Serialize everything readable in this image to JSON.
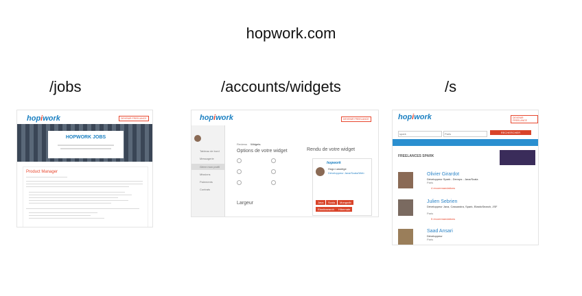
{
  "page": {
    "title": "hopwork.com",
    "labels": [
      "/jobs",
      "/accounts/widgets",
      "/s"
    ]
  },
  "jobs": {
    "logo": "hopwork",
    "banner_title": "HOPWORK JOBS",
    "post_title": "Product Manager",
    "cta": "DEVENIR FREELANCE"
  },
  "widgets": {
    "logo": "hopwork",
    "cta": "DEVENIR FREELANCE",
    "tabs": [
      "Reviews",
      "Widgets"
    ],
    "options_title": "Options de votre widget",
    "render_title": "Rendu de votre widget",
    "largeur": "Largeur",
    "sidebar": [
      "Tableau de bord",
      "Messagerie",
      "Gérer mon profil",
      "Missions",
      "Paiements",
      "Contrats"
    ],
    "card_name": "Hugo Lassiège",
    "card_role": "Développeur Java/Scala/Web",
    "card_brand": "hopwork",
    "card_tags": [
      "Java",
      "Scala",
      "Mongodb",
      "Elasticsearch",
      "Hibernate",
      "JS"
    ]
  },
  "search": {
    "logo": "hopwork",
    "cta": "DEVENIR FREELANCE",
    "search_value": "spark",
    "location_value": "Paris",
    "search_button": "RECHERCHER",
    "section_title": "FREELANCES SPARK",
    "results": [
      {
        "name": "Olivier Girardot",
        "title": "Développeur Spark - Devops - Java/Scala",
        "city": "Paris",
        "reco": "4 recommandations"
      },
      {
        "name": "Julien Sebrien",
        "title": "Développeur Java, Cassandra, Spark, ElasticSearch, JSF",
        "city": "Paris",
        "reco": "5 recommandations"
      },
      {
        "name": "Saad Ansari",
        "title": "Développeur",
        "city": "Paris",
        "reco": ""
      }
    ]
  },
  "colors": {
    "brand_blue": "#1a7fc1",
    "brand_red": "#e8452c",
    "search_bar": "#2a8fd0"
  }
}
